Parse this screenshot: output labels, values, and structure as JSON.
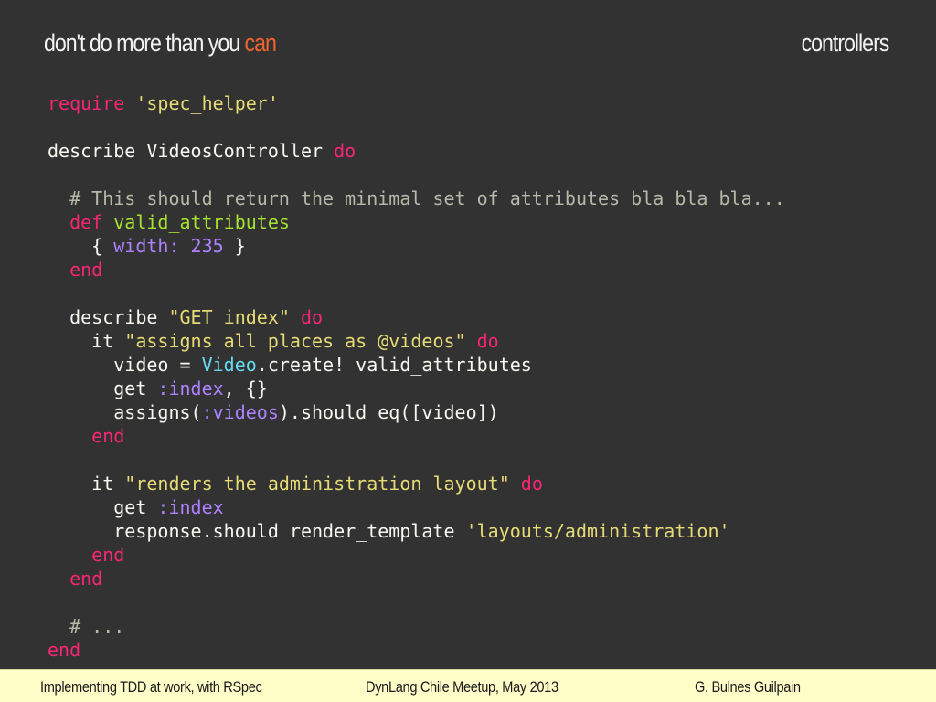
{
  "header": {
    "title_prefix": "don't do more than you ",
    "title_accent": "can",
    "section": "controllers"
  },
  "colors": {
    "background": "#323232",
    "title_accent": "#f0642f",
    "keyword": "#f92672",
    "string": "#e6db74",
    "comment": "#b8b8a8",
    "method_name": "#a6e22e",
    "symbol_number": "#ae81ff",
    "constant": "#66d9ef",
    "footer_background": "#fffdc8"
  },
  "code": [
    [
      [
        "kw",
        "require"
      ],
      [
        "tx",
        " "
      ],
      [
        "str",
        "'spec_helper'"
      ]
    ],
    [],
    [
      [
        "tx",
        "describe VideosController "
      ],
      [
        "kw",
        "do"
      ]
    ],
    [],
    [
      [
        "cm",
        "  # This should return the minimal set of attributes bla bla bla..."
      ]
    ],
    [
      [
        "kw",
        "  def "
      ],
      [
        "fn",
        "valid_attributes"
      ]
    ],
    [
      [
        "tx",
        "    { "
      ],
      [
        "sym",
        "width:"
      ],
      [
        "tx",
        " "
      ],
      [
        "sym",
        "235"
      ],
      [
        "tx",
        " }"
      ]
    ],
    [
      [
        "kw",
        "  end"
      ]
    ],
    [],
    [
      [
        "tx",
        "  describe "
      ],
      [
        "str",
        "\"GET index\""
      ],
      [
        "tx",
        " "
      ],
      [
        "kw",
        "do"
      ]
    ],
    [
      [
        "tx",
        "    it "
      ],
      [
        "str",
        "\"assigns all places as @videos\""
      ],
      [
        "tx",
        " "
      ],
      [
        "kw",
        "do"
      ]
    ],
    [
      [
        "tx",
        "      video = "
      ],
      [
        "cls",
        "Video"
      ],
      [
        "tx",
        ".create! valid_attributes"
      ]
    ],
    [
      [
        "tx",
        "      get "
      ],
      [
        "sym",
        ":index"
      ],
      [
        "tx",
        ", {}"
      ]
    ],
    [
      [
        "tx",
        "      assigns("
      ],
      [
        "sym",
        ":videos"
      ],
      [
        "tx",
        ").should eq([video])"
      ]
    ],
    [
      [
        "kw",
        "    end"
      ]
    ],
    [],
    [
      [
        "tx",
        "    it "
      ],
      [
        "str",
        "\"renders the administration layout\""
      ],
      [
        "tx",
        " "
      ],
      [
        "kw",
        "do"
      ]
    ],
    [
      [
        "tx",
        "      get "
      ],
      [
        "sym",
        ":index"
      ]
    ],
    [
      [
        "tx",
        "      response.should render_template "
      ],
      [
        "str",
        "'layouts/administration'"
      ]
    ],
    [
      [
        "kw",
        "    end"
      ]
    ],
    [
      [
        "kw",
        "  end"
      ]
    ],
    [],
    [
      [
        "cm",
        "  # ..."
      ]
    ],
    [
      [
        "kw",
        "end"
      ]
    ]
  ],
  "footer": {
    "left": "Implementing TDD at work, with RSpec",
    "center": "DynLang Chile Meetup, May 2013",
    "right": "G. Bulnes Guilpain"
  }
}
